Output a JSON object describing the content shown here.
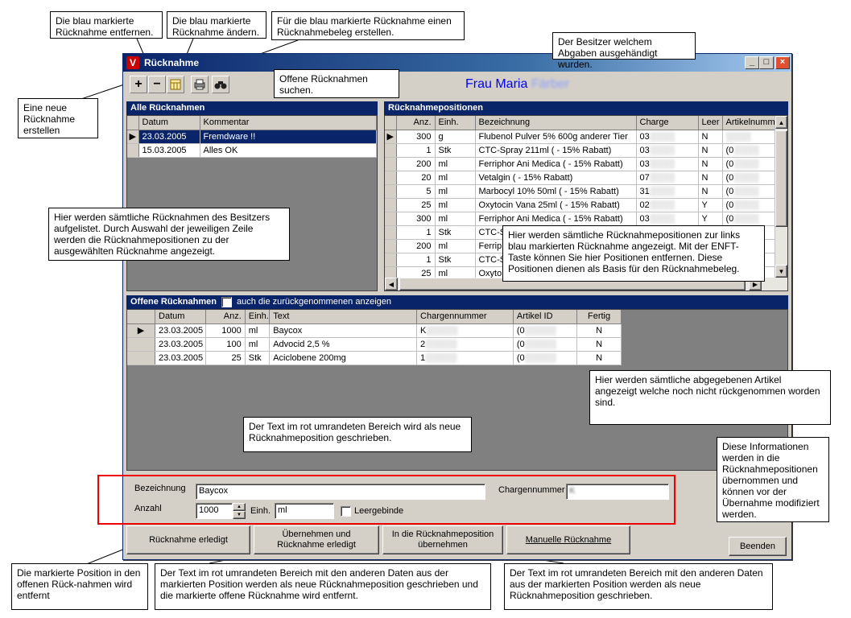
{
  "window": {
    "title": "Rücknahme",
    "owner_first": "Frau Maria",
    "owner_last": "Färber"
  },
  "toolbar": {
    "add": "+",
    "remove": "−"
  },
  "returns_panel": {
    "title": "Alle Rücknahmen",
    "columns": [
      "Datum",
      "Kommentar"
    ],
    "rows": [
      {
        "date": "23.03.2005",
        "comment": "Fremdware !!"
      },
      {
        "date": "15.03.2005",
        "comment": "Alles OK"
      }
    ]
  },
  "positions_panel": {
    "title": "Rücknahmepositionen",
    "columns": [
      "Anz.",
      "Einh.",
      "Bezeichnung",
      "Charge",
      "Leer",
      "Artikelnumm"
    ],
    "rows": [
      {
        "qty": "300",
        "unit": "g",
        "name": "Flubenol Pulver 5% 600g anderer Tier",
        "charge": "03",
        "empty": "N",
        "artno": ""
      },
      {
        "qty": "1",
        "unit": "Stk",
        "name": "CTC-Spray 211ml ( - 15% Rabatt)",
        "charge": "03",
        "empty": "N",
        "artno": "(0"
      },
      {
        "qty": "200",
        "unit": "ml",
        "name": "Ferriphor Ani Medica ( - 15% Rabatt)",
        "charge": "03",
        "empty": "N",
        "artno": "(0"
      },
      {
        "qty": "20",
        "unit": "ml",
        "name": "Vetalgin ( - 15% Rabatt)",
        "charge": "07",
        "empty": "N",
        "artno": "(0"
      },
      {
        "qty": "5",
        "unit": "ml",
        "name": "Marbocyl 10%  50ml ( - 15% Rabatt)",
        "charge": "31",
        "empty": "N",
        "artno": "(0"
      },
      {
        "qty": "25",
        "unit": "ml",
        "name": "Oxytocin Vana 25ml ( - 15% Rabatt)",
        "charge": "02",
        "empty": "Y",
        "artno": "(0"
      },
      {
        "qty": "300",
        "unit": "ml",
        "name": "Ferriphor Ani Medica ( - 15% Rabatt)",
        "charge": "03",
        "empty": "Y",
        "artno": "(0"
      },
      {
        "qty": "1",
        "unit": "Stk",
        "name": "CTC-S",
        "charge": "",
        "empty": "",
        "artno": ""
      },
      {
        "qty": "200",
        "unit": "ml",
        "name": "Ferripl",
        "charge": "",
        "empty": "",
        "artno": ""
      },
      {
        "qty": "1",
        "unit": "Stk",
        "name": "CTC-S",
        "charge": "",
        "empty": "",
        "artno": ""
      },
      {
        "qty": "25",
        "unit": "ml",
        "name": "Oxyto",
        "charge": "",
        "empty": "",
        "artno": ""
      }
    ]
  },
  "open_panel": {
    "title": "Offene Rücknahmen",
    "checkbox_label": "auch die zurückgenommenen anzeigen",
    "columns": [
      "Datum",
      "Anz.",
      "Einh.",
      "Text",
      "Chargennummer",
      "Artikel ID",
      "Fertig"
    ],
    "rows": [
      {
        "date": "23.03.2005",
        "qty": "1000",
        "unit": "ml",
        "text": "Baycox",
        "charge": "K",
        "artid": "(0",
        "done": "N"
      },
      {
        "date": "23.03.2005",
        "qty": "100",
        "unit": "ml",
        "text": "Advocid 2,5 %",
        "charge": "2",
        "artid": "(0",
        "done": "N"
      },
      {
        "date": "23.03.2005",
        "qty": "25",
        "unit": "Stk",
        "text": "Aciclobene 200mg",
        "charge": "1",
        "artid": "(0",
        "done": "N"
      }
    ]
  },
  "form": {
    "label_name": "Bezeichnung",
    "value_name": "Baycox",
    "label_charge": "Chargennummer",
    "value_charge": "K",
    "label_qty": "Anzahl",
    "value_qty": "1000",
    "label_unit": "Einh.",
    "value_unit": "ml",
    "label_empty": "Leergebinde"
  },
  "buttons": {
    "done": "Rücknahme erledigt",
    "take_done_1": "Übernehmen und",
    "take_done_2": "Rücknahme erledigt",
    "to_pos_1": "In die Rücknahmeposition",
    "to_pos_2": "übernehmen",
    "manual": "Manuelle Rücknahme",
    "exit": "Beenden"
  },
  "callouts": {
    "c_remove": "Die blau markierte Rücknahme entfernen.",
    "c_edit": "Die blau markierte Rücknahme ändern.",
    "c_print": "Für die blau markierte Rücknahme einen Rücknahmebeleg erstellen.",
    "c_owner": "Der Besitzer welchem Abgaben ausgehändigt wurden.",
    "c_new": "Eine neue Rücknahme erstellen",
    "c_search": "Offene Rücknahmen suchen.",
    "c_list": "Hier werden sämtliche Rücknahmen des Besitzers aufgelistet. Durch Auswahl der jeweiligen Zeile werden die Rücknahmepositionen zu der ausgewählten Rücknahme angezeigt.",
    "c_positions": "Hier werden sämtliche Rücknahmepositionen zur links blau markierten Rücknahme angezeigt. Mit der ENFT-Taste können Sie hier Positionen entfernen. Diese Positionen dienen als Basis für den Rücknahmebeleg.",
    "c_open": "Hier werden sämtliche abgegebenen Artikel angezeigt welche noch nicht rückgenommen worden sind.",
    "c_redtext": "Der Text im rot umrandeten Bereich wird  als neue Rücknahmeposition geschrieben.",
    "c_info": "Diese Informationen werden in die Rücknahmepositionen übernommen und können vor der Übernahme modifiziert werden.",
    "c_done": "Die markierte Position in den offenen Rück-nahmen wird entfernt",
    "c_takedone": "Der Text im rot umrandeten Bereich mit den anderen Daten aus der markierten Position werden als neue Rücknahmeposition geschrieben und die markierte offene Rücknahme wird entfernt.",
    "c_topos": "Der Text im rot umrandeten Bereich mit den anderen Daten aus der markierten Position werden als neue Rücknahmeposition geschrieben."
  }
}
